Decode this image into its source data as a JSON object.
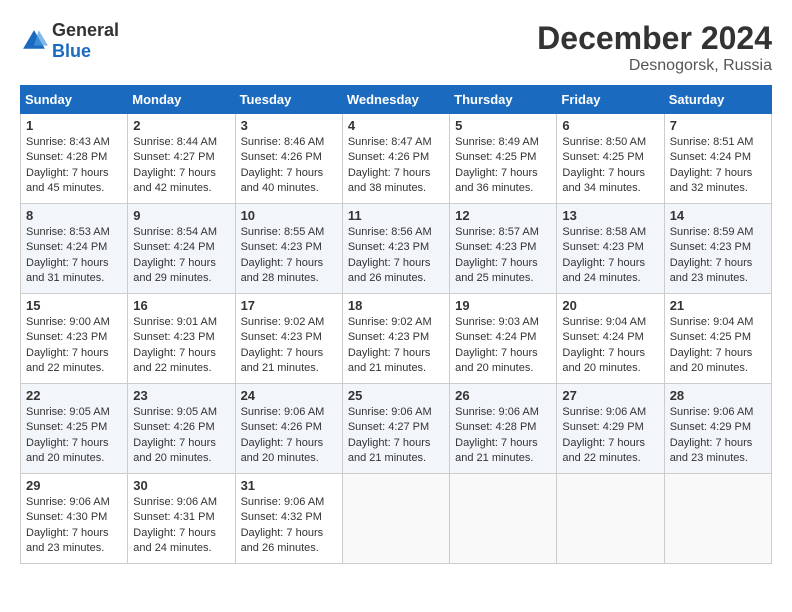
{
  "header": {
    "logo_general": "General",
    "logo_blue": "Blue",
    "month_title": "December 2024",
    "location": "Desnogorsk, Russia"
  },
  "weekdays": [
    "Sunday",
    "Monday",
    "Tuesday",
    "Wednesday",
    "Thursday",
    "Friday",
    "Saturday"
  ],
  "weeks": [
    [
      {
        "day": "1",
        "sunrise": "8:43 AM",
        "sunset": "4:28 PM",
        "daylight": "7 hours and 45 minutes."
      },
      {
        "day": "2",
        "sunrise": "8:44 AM",
        "sunset": "4:27 PM",
        "daylight": "7 hours and 42 minutes."
      },
      {
        "day": "3",
        "sunrise": "8:46 AM",
        "sunset": "4:26 PM",
        "daylight": "7 hours and 40 minutes."
      },
      {
        "day": "4",
        "sunrise": "8:47 AM",
        "sunset": "4:26 PM",
        "daylight": "7 hours and 38 minutes."
      },
      {
        "day": "5",
        "sunrise": "8:49 AM",
        "sunset": "4:25 PM",
        "daylight": "7 hours and 36 minutes."
      },
      {
        "day": "6",
        "sunrise": "8:50 AM",
        "sunset": "4:25 PM",
        "daylight": "7 hours and 34 minutes."
      },
      {
        "day": "7",
        "sunrise": "8:51 AM",
        "sunset": "4:24 PM",
        "daylight": "7 hours and 32 minutes."
      }
    ],
    [
      {
        "day": "8",
        "sunrise": "8:53 AM",
        "sunset": "4:24 PM",
        "daylight": "7 hours and 31 minutes."
      },
      {
        "day": "9",
        "sunrise": "8:54 AM",
        "sunset": "4:24 PM",
        "daylight": "7 hours and 29 minutes."
      },
      {
        "day": "10",
        "sunrise": "8:55 AM",
        "sunset": "4:23 PM",
        "daylight": "7 hours and 28 minutes."
      },
      {
        "day": "11",
        "sunrise": "8:56 AM",
        "sunset": "4:23 PM",
        "daylight": "7 hours and 26 minutes."
      },
      {
        "day": "12",
        "sunrise": "8:57 AM",
        "sunset": "4:23 PM",
        "daylight": "7 hours and 25 minutes."
      },
      {
        "day": "13",
        "sunrise": "8:58 AM",
        "sunset": "4:23 PM",
        "daylight": "7 hours and 24 minutes."
      },
      {
        "day": "14",
        "sunrise": "8:59 AM",
        "sunset": "4:23 PM",
        "daylight": "7 hours and 23 minutes."
      }
    ],
    [
      {
        "day": "15",
        "sunrise": "9:00 AM",
        "sunset": "4:23 PM",
        "daylight": "7 hours and 22 minutes."
      },
      {
        "day": "16",
        "sunrise": "9:01 AM",
        "sunset": "4:23 PM",
        "daylight": "7 hours and 22 minutes."
      },
      {
        "day": "17",
        "sunrise": "9:02 AM",
        "sunset": "4:23 PM",
        "daylight": "7 hours and 21 minutes."
      },
      {
        "day": "18",
        "sunrise": "9:02 AM",
        "sunset": "4:23 PM",
        "daylight": "7 hours and 21 minutes."
      },
      {
        "day": "19",
        "sunrise": "9:03 AM",
        "sunset": "4:24 PM",
        "daylight": "7 hours and 20 minutes."
      },
      {
        "day": "20",
        "sunrise": "9:04 AM",
        "sunset": "4:24 PM",
        "daylight": "7 hours and 20 minutes."
      },
      {
        "day": "21",
        "sunrise": "9:04 AM",
        "sunset": "4:25 PM",
        "daylight": "7 hours and 20 minutes."
      }
    ],
    [
      {
        "day": "22",
        "sunrise": "9:05 AM",
        "sunset": "4:25 PM",
        "daylight": "7 hours and 20 minutes."
      },
      {
        "day": "23",
        "sunrise": "9:05 AM",
        "sunset": "4:26 PM",
        "daylight": "7 hours and 20 minutes."
      },
      {
        "day": "24",
        "sunrise": "9:06 AM",
        "sunset": "4:26 PM",
        "daylight": "7 hours and 20 minutes."
      },
      {
        "day": "25",
        "sunrise": "9:06 AM",
        "sunset": "4:27 PM",
        "daylight": "7 hours and 21 minutes."
      },
      {
        "day": "26",
        "sunrise": "9:06 AM",
        "sunset": "4:28 PM",
        "daylight": "7 hours and 21 minutes."
      },
      {
        "day": "27",
        "sunrise": "9:06 AM",
        "sunset": "4:29 PM",
        "daylight": "7 hours and 22 minutes."
      },
      {
        "day": "28",
        "sunrise": "9:06 AM",
        "sunset": "4:29 PM",
        "daylight": "7 hours and 23 minutes."
      }
    ],
    [
      {
        "day": "29",
        "sunrise": "9:06 AM",
        "sunset": "4:30 PM",
        "daylight": "7 hours and 23 minutes."
      },
      {
        "day": "30",
        "sunrise": "9:06 AM",
        "sunset": "4:31 PM",
        "daylight": "7 hours and 24 minutes."
      },
      {
        "day": "31",
        "sunrise": "9:06 AM",
        "sunset": "4:32 PM",
        "daylight": "7 hours and 26 minutes."
      },
      null,
      null,
      null,
      null
    ]
  ],
  "labels": {
    "sunrise_prefix": "Sunrise: ",
    "sunset_prefix": "Sunset: ",
    "daylight_prefix": "Daylight: "
  }
}
